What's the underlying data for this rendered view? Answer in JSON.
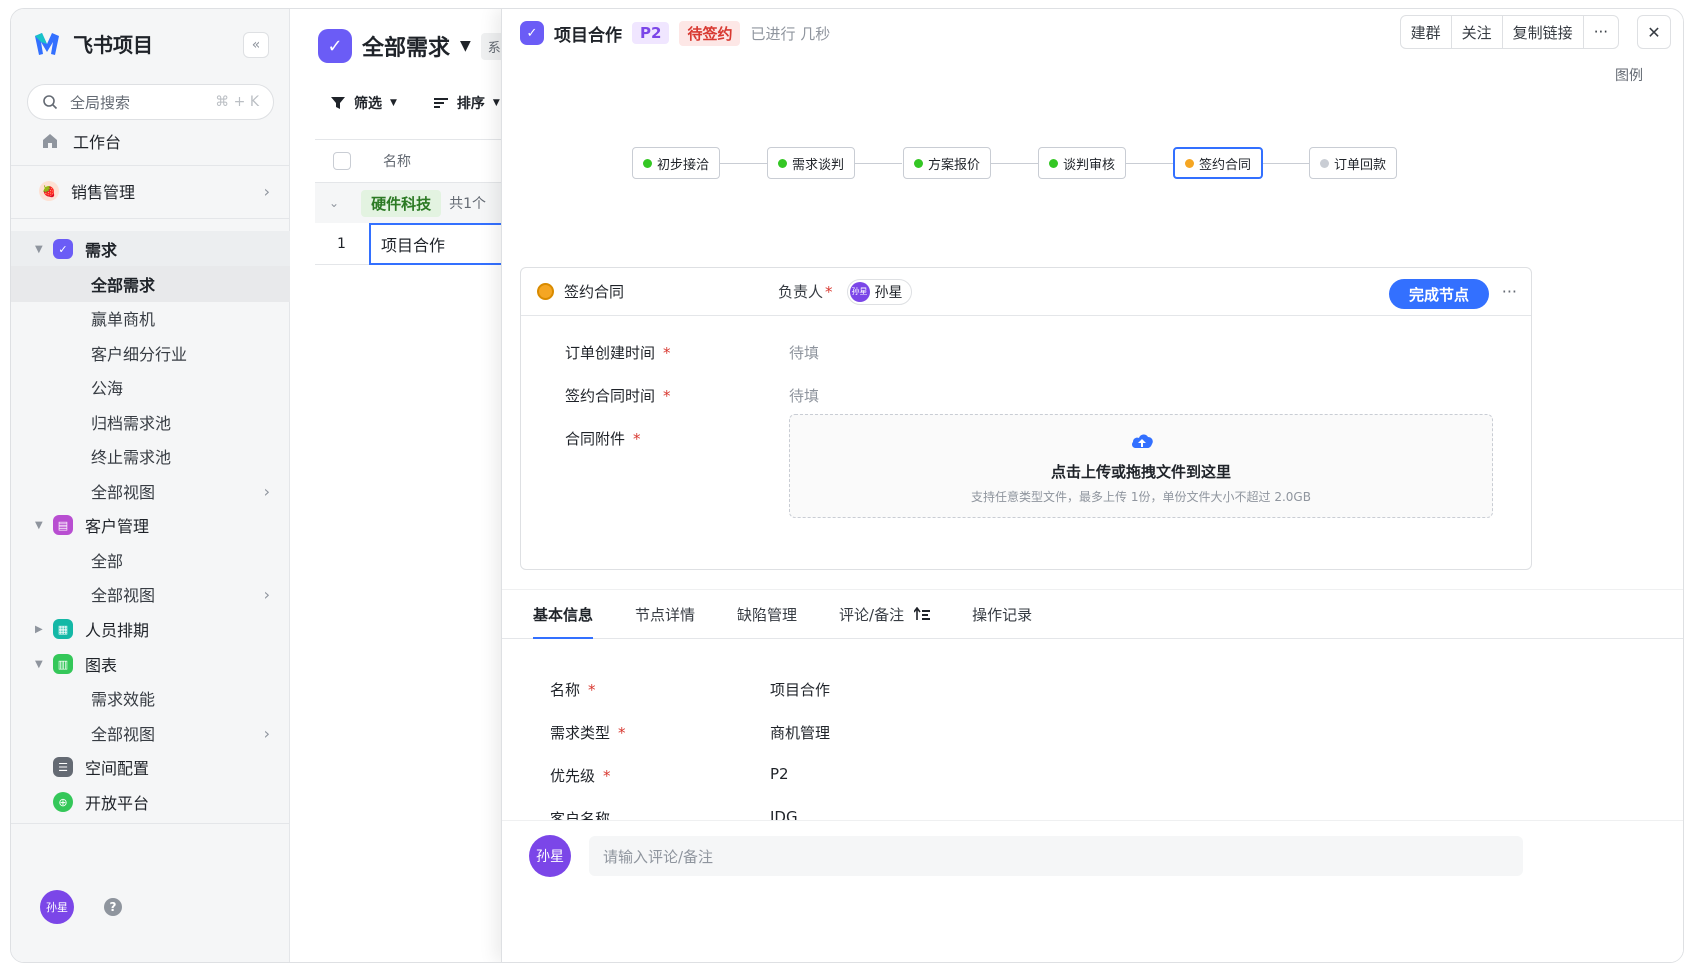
{
  "app": {
    "name": "飞书项目",
    "collapse_icon": "«"
  },
  "search": {
    "label": "全局搜索",
    "shortcut": "⌘ + K"
  },
  "sidebar": {
    "workbench": "工作台",
    "sales": "销售管理",
    "sections": [
      {
        "label": "需求",
        "color": "#6b5cf6",
        "items": [
          "全部需求",
          "赢单商机",
          "客户细分行业",
          "公海",
          "归档需求池",
          "终止需求池",
          "全部视图"
        ]
      },
      {
        "label": "客户管理",
        "color": "#b84ed1",
        "items": [
          "全部",
          "全部视图"
        ]
      },
      {
        "label": "人员排期",
        "color": "#14b8a6"
      },
      {
        "label": "图表",
        "color": "#34c759",
        "items": [
          "需求效能",
          "全部视图"
        ]
      },
      {
        "label": "空间配置",
        "color": "#646a73"
      },
      {
        "label": "开放平台",
        "color": "#34c759"
      }
    ],
    "user_avatar": "孙星",
    "help": "?"
  },
  "list": {
    "title": "全部需求",
    "system_tag": "系统视",
    "filter": "筛选",
    "sort": "排序",
    "col_name": "名称",
    "group": {
      "tag": "硬件科技",
      "count": "共1个"
    },
    "rows": [
      {
        "num": "1",
        "name": "项目合作"
      }
    ]
  },
  "detail": {
    "title": "项目合作",
    "priority": "P2",
    "status": "待签约",
    "elapsed": "已进行 几秒",
    "actions": [
      "建群",
      "关注",
      "复制链接",
      "···"
    ],
    "close": "✕",
    "legend": "图例",
    "flow": [
      {
        "label": "初步接洽",
        "state": "done"
      },
      {
        "label": "需求谈判",
        "state": "done"
      },
      {
        "label": "方案报价",
        "state": "done"
      },
      {
        "label": "谈判审核",
        "state": "done"
      },
      {
        "label": "签约合同",
        "state": "current"
      },
      {
        "label": "订单回款",
        "state": "todo"
      }
    ],
    "node": {
      "name": "签约合同",
      "owner_label": "负责人",
      "owner": "孙星",
      "owner_avatar": "孙星",
      "complete": "完成节点",
      "more": "···",
      "fields": [
        {
          "label": "订单创建时间",
          "value": "待填"
        },
        {
          "label": "签约合同时间",
          "value": "待填"
        },
        {
          "label": "合同附件",
          "value": ""
        }
      ],
      "upload_title": "点击上传或拖拽文件到这里",
      "upload_desc": "支持任意类型文件，最多上传 1份，单份文件大小不超过 2.0GB"
    },
    "tabs": [
      "基本信息",
      "节点详情",
      "缺陷管理",
      "评论/备注",
      "操作记录"
    ],
    "info": [
      {
        "label": "名称",
        "value": "项目合作",
        "required": true
      },
      {
        "label": "需求类型",
        "value": "商机管理",
        "required": true
      },
      {
        "label": "优先级",
        "value": "P2",
        "required": true
      },
      {
        "label": "客户名称",
        "value": "IDG",
        "required": false
      }
    ],
    "comment": {
      "avatar": "孙星",
      "placeholder": "请输入评论/备注"
    }
  }
}
